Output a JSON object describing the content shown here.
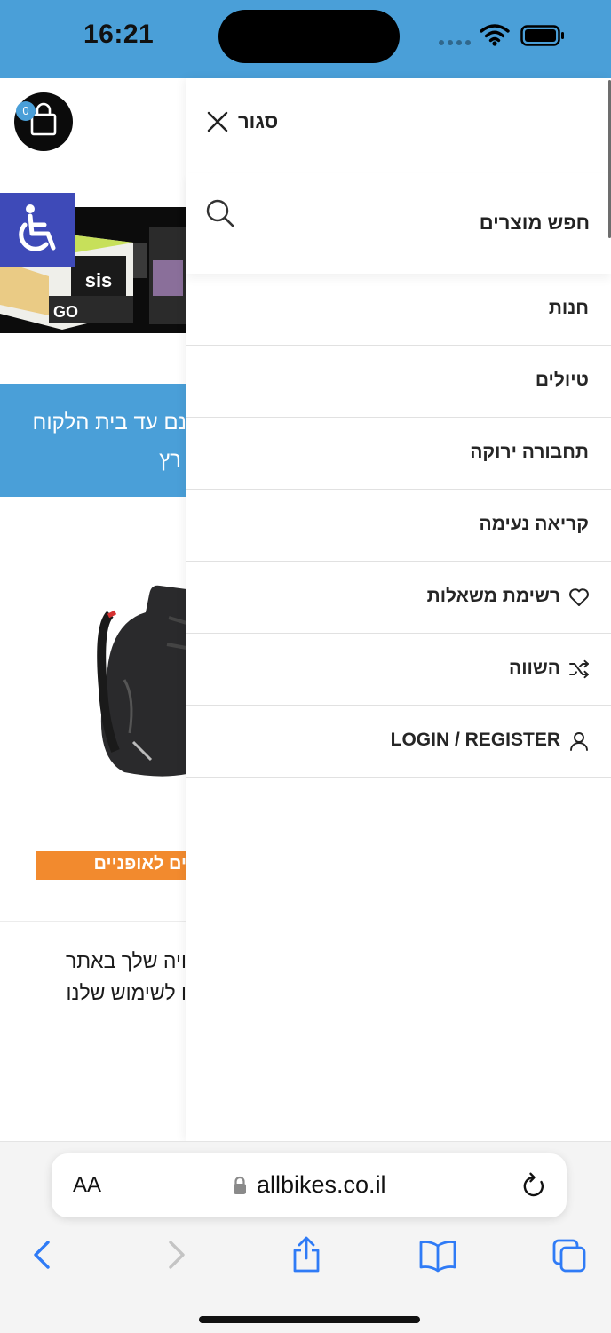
{
  "status_bar": {
    "time": "16:21"
  },
  "background_page": {
    "cart_count": "0",
    "blue_strip_line1": "נם עד בית הלקוח",
    "blue_strip_line2": "רץ",
    "orange_tag": "ים לאופניים",
    "cookie_line1": "ויה שלך באתר",
    "cookie_line2": "ו לשימוש שלנו",
    "banner_product_label": "GO"
  },
  "drawer": {
    "close_label": "סגור",
    "search_placeholder": "חפש מוצרים",
    "items": [
      {
        "label": "חנות",
        "icon": "none"
      },
      {
        "label": "טיולים",
        "icon": "none"
      },
      {
        "label": "תחבורה ירוקה",
        "icon": "none"
      },
      {
        "label": "קריאה נעימה",
        "icon": "none"
      },
      {
        "label": "רשימת משאלות",
        "icon": "heart-icon"
      },
      {
        "label": "השווה",
        "icon": "shuffle-icon"
      },
      {
        "label": "LOGIN / REGISTER",
        "icon": "user-icon"
      }
    ]
  },
  "browser": {
    "text_size_label": "AA",
    "url": "allbikes.co.il"
  },
  "colors": {
    "status_bar": "#4a9fd8",
    "accessibility": "#3e4ab8",
    "orange_tag": "#f28a2e",
    "ios_blue": "#2f7bf6"
  }
}
